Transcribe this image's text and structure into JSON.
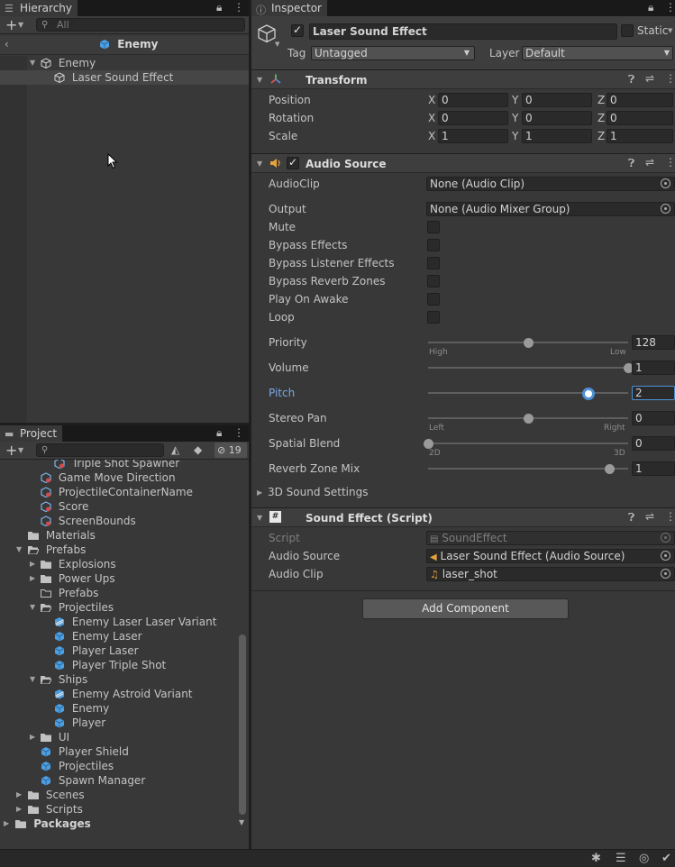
{
  "hierarchy": {
    "tab": "Hierarchy",
    "search_placeholder": "All",
    "breadcrumb": "Enemy",
    "items": [
      {
        "label": "Enemy"
      },
      {
        "label": "Laser Sound Effect"
      }
    ]
  },
  "project": {
    "tab": "Project",
    "hidden_count": "19",
    "items": [
      {
        "label": "Triple Shot Spawner"
      },
      {
        "label": "Game Move Direction"
      },
      {
        "label": "ProjectileContainerName"
      },
      {
        "label": "Score"
      },
      {
        "label": "ScreenBounds"
      },
      {
        "label": "Materials"
      },
      {
        "label": "Prefabs"
      },
      {
        "label": "Explosions"
      },
      {
        "label": "Power Ups"
      },
      {
        "label": "Prefabs"
      },
      {
        "label": "Projectiles"
      },
      {
        "label": "Enemy Laser Laser Variant"
      },
      {
        "label": "Enemy Laser"
      },
      {
        "label": "Player Laser"
      },
      {
        "label": "Player Triple Shot"
      },
      {
        "label": "Ships"
      },
      {
        "label": "Enemy Astroid Variant"
      },
      {
        "label": "Enemy"
      },
      {
        "label": "Player"
      },
      {
        "label": "UI"
      },
      {
        "label": "Player Shield"
      },
      {
        "label": "Projectiles"
      },
      {
        "label": "Spawn Manager"
      },
      {
        "label": "Scenes"
      },
      {
        "label": "Scripts"
      },
      {
        "label": "Packages"
      }
    ]
  },
  "inspector": {
    "tab": "Inspector",
    "object_name": "Laser Sound Effect",
    "static_label": "Static",
    "tag_label": "Tag",
    "tag_value": "Untagged",
    "layer_label": "Layer",
    "layer_value": "Default",
    "transform": {
      "title": "Transform",
      "position": {
        "label": "Position",
        "x": "0",
        "y": "0",
        "z": "0"
      },
      "rotation": {
        "label": "Rotation",
        "x": "0",
        "y": "0",
        "z": "0"
      },
      "scale": {
        "label": "Scale",
        "x": "1",
        "y": "1",
        "z": "1"
      }
    },
    "axis": {
      "x": "X",
      "y": "Y",
      "z": "Z"
    },
    "audio_source": {
      "title": "Audio Source",
      "audioclip_label": "AudioClip",
      "audioclip_value": "None (Audio Clip)",
      "output_label": "Output",
      "output_value": "None (Audio Mixer Group)",
      "mute": "Mute",
      "bypass_effects": "Bypass Effects",
      "bypass_listener": "Bypass Listener Effects",
      "bypass_reverb": "Bypass Reverb Zones",
      "play_on_awake": "Play On Awake",
      "loop": "Loop",
      "priority": {
        "label": "Priority",
        "value": "128",
        "min_label": "High",
        "max_label": "Low",
        "fraction": 0.5
      },
      "volume": {
        "label": "Volume",
        "value": "1",
        "fraction": 1.0
      },
      "pitch": {
        "label": "Pitch",
        "value": "2",
        "fraction": 0.8
      },
      "stereo_pan": {
        "label": "Stereo Pan",
        "value": "0",
        "min_label": "Left",
        "max_label": "Right",
        "fraction": 0.5
      },
      "spatial_blend": {
        "label": "Spatial Blend",
        "value": "0",
        "min_label": "2D",
        "max_label": "3D",
        "fraction": 0.0
      },
      "reverb_mix": {
        "label": "Reverb Zone Mix",
        "value": "1",
        "fraction": 0.909
      },
      "sound_settings": "3D Sound Settings"
    },
    "sound_effect": {
      "title": "Sound Effect (Script)",
      "script_label": "Script",
      "script_value": "SoundEffect",
      "audio_source_label": "Audio Source",
      "audio_source_value": "Laser Sound Effect (Audio Source)",
      "audio_clip_label": "Audio Clip",
      "audio_clip_value": "laser_shot"
    },
    "add_component": "Add Component"
  },
  "colors": {
    "accent": "#4d8fd6",
    "pitch_label": "#7ba7e6"
  }
}
